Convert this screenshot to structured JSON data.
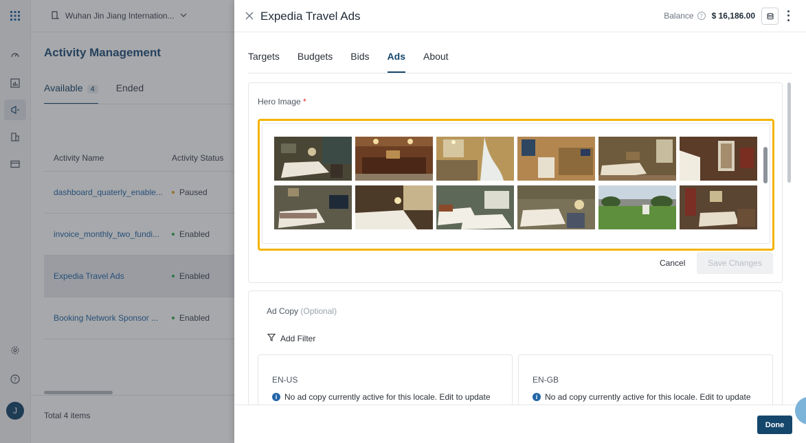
{
  "topbar": {
    "property": "Wuhan Jin Jiang Internation..."
  },
  "page": {
    "title": "Activity Management",
    "tabs": [
      {
        "label": "Available",
        "count": "4"
      },
      {
        "label": "Ended"
      }
    ],
    "table": {
      "headers": [
        "Activity Name",
        "Activity Status"
      ],
      "rows": [
        {
          "name": "dashboard_quaterly_enable...",
          "status": "Paused"
        },
        {
          "name": "invoice_monthly_two_fundi...",
          "status": "Enabled"
        },
        {
          "name": "Expedia Travel Ads",
          "status": "Enabled"
        },
        {
          "name": "Booking Network Sponsor ...",
          "status": "Enabled"
        }
      ]
    },
    "total": "Total 4 items"
  },
  "user": {
    "initial": "J"
  },
  "drawer": {
    "title": "Expedia Travel Ads",
    "balance_label": "Balance",
    "balance_value": "$ 16,186.00",
    "tabs": [
      "Targets",
      "Budgets",
      "Bids",
      "Ads",
      "About"
    ],
    "active_tab": "Ads",
    "hero": {
      "label": "Hero Image",
      "required_mark": "*",
      "cancel_label": "Cancel",
      "save_label": "Save Changes"
    },
    "adcopy": {
      "label": "Ad Copy",
      "optional": "(Optional)",
      "filter_label": "Add Filter",
      "locales": [
        {
          "code": "EN-US",
          "message": "No ad copy currently active for this locale. Edit to update"
        },
        {
          "code": "EN-GB",
          "message": "No ad copy currently active for this locale. Edit to update"
        }
      ]
    },
    "done_label": "Done"
  },
  "colors": {
    "accent": "#15466b",
    "highlight": "#f4b400",
    "link": "#2266a8"
  }
}
